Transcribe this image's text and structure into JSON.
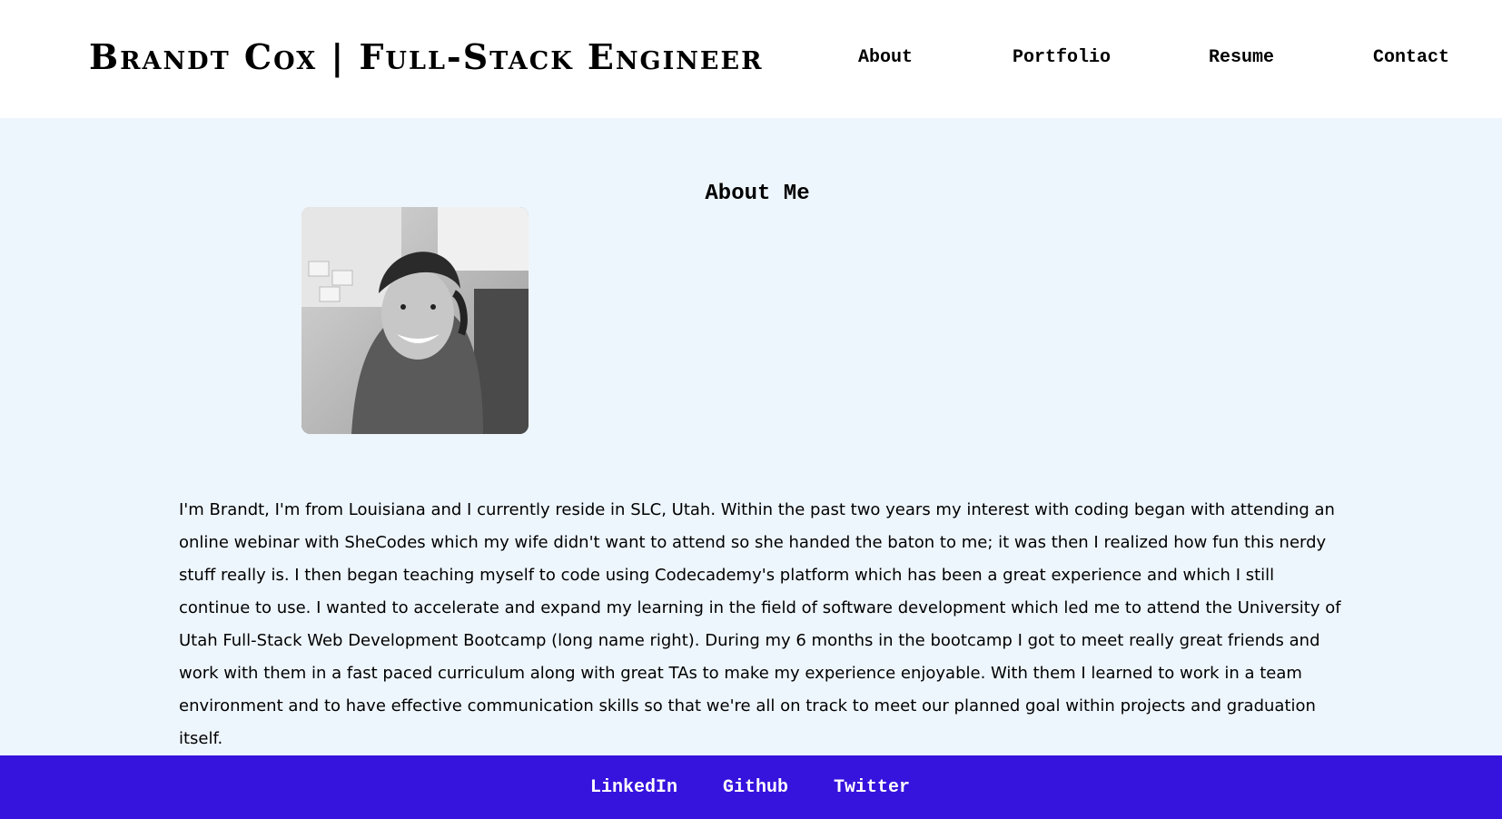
{
  "header": {
    "brand": "Brandt Cox | Full-Stack Engineer",
    "nav": {
      "about": "About",
      "portfolio": "Portfolio",
      "resume": "Resume",
      "contact": "Contact"
    }
  },
  "about": {
    "title": "About Me",
    "photo_icon": "profile-photo",
    "bio": "I'm Brandt, I'm from Louisiana and I currently reside in SLC, Utah. Within the past two years my interest with coding began with attending an online webinar with SheCodes which my wife didn't want to attend so she handed the baton to me; it was then I realized how fun this nerdy stuff really is. I then began teaching myself to code using Codecademy's platform which has been a great experience and which I still continue to use. I wanted to accelerate and expand my learning in the field of software development which led me to attend the University of Utah Full-Stack Web Development Bootcamp (long name right). During my 6 months in the bootcamp I got to meet really great friends and work with them in a fast paced curriculum along with great TAs to make my experience enjoyable. With them I learned to work in a team environment and to have effective communication skills so that we're all on track to meet our planned goal within projects and graduation itself."
  },
  "footer": {
    "linkedin": "LinkedIn",
    "github": "Github",
    "twitter": "Twitter"
  },
  "colors": {
    "main_background": "#eef6fd",
    "footer_background": "#3713de",
    "footer_text": "#ffffff"
  }
}
